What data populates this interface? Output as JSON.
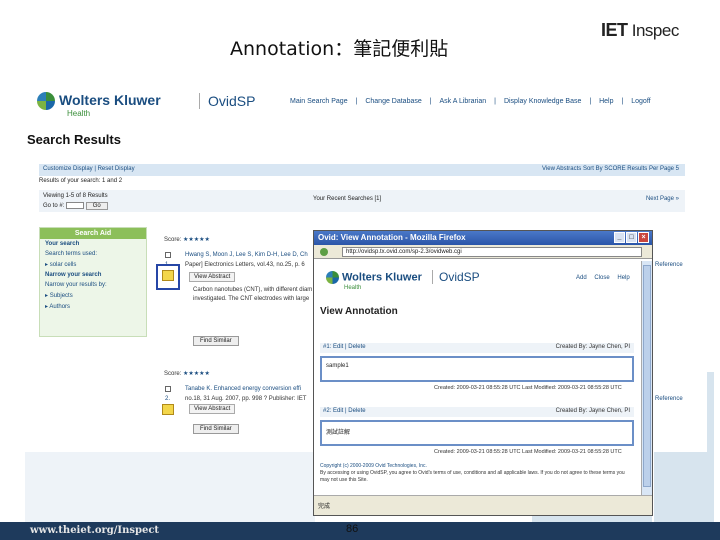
{
  "slide": {
    "title": "Annotation：筆記便利貼",
    "logo_iet": "IET",
    "logo_inspec": "Inspec",
    "footer_url": "www.theiet.org/Inspect",
    "page_number": "86"
  },
  "ovid": {
    "brand": "Wolters Kluwer",
    "brand_sub": "Health",
    "product": "OvidSP",
    "nav": [
      "Main Search Page",
      "|",
      "Change Database",
      "|",
      "Ask A Librarian",
      "|",
      "Display Knowledge Base",
      "|",
      "Help",
      "|",
      "Logoff"
    ],
    "page_title": "Search Results",
    "customize_display": "Customize Display",
    "reset_display": "Reset Display",
    "sort_right": "View Abstracts   Sort By  SCORE   Results Per Page  5",
    "results_header": "Results of your search: 1 and 2",
    "viewing": "Viewing 1-5 of 8 Results",
    "goto": "Go to #:",
    "goto_btn": "Go",
    "recent_searches": "Your Recent Searches [1]",
    "next_page": "Next Page",
    "search_aid": {
      "header": "Search Aid",
      "your_search": "Your search",
      "terms_used": "Search terms used:",
      "term": "solar cells",
      "narrow": "Narrow your search",
      "narrow_by": "Narrow your results by:",
      "subjects": "Subjects",
      "authors": "Authors"
    },
    "records": [
      {
        "score_label": "Score:",
        "stars": "★★★★★",
        "number": "1.",
        "authors": "Hwang S, Moon J, Lee S, Kim D-H, Lee D, Ch",
        "source": "Paper] Electronics Letters, vol.43, no.25, p. 6",
        "view_abstract": "View Abstract",
        "abstract": "Carbon nanotubes (CNT), with different diam",
        "abstract2": "investigated. The CNT electrodes with large",
        "find_similar": "Find Similar",
        "reference": "Reference"
      },
      {
        "score_label": "Score:",
        "stars": "★★★★★",
        "number": "2.",
        "authors": "Tanabe K. Enhanced energy conversion effi",
        "source": "no.18, 31 Aug. 2007, pp. 998 ? Publisher: IET",
        "view_abstract": "View Abstract",
        "find_similar": "Find Similar",
        "reference": "Reference"
      }
    ]
  },
  "popup": {
    "window_title": "Ovid: View Annotation - Mozilla Firefox",
    "url": "http://ovidsp.tx.ovid.com/sp-2.3/ovidweb.cgi",
    "brand": "Wolters Kluwer",
    "brand_sub": "Health",
    "product": "OvidSP",
    "nav": [
      "Add",
      "Close",
      "Help"
    ],
    "heading": "View Annotation",
    "annotations": [
      {
        "tag": "#1: Edit  |  Delete",
        "created_by": "Created By: Jayne Chen, PI",
        "text": "sample1",
        "meta": "Created: 2009-03-21 08:55:28 UTC     Last Modified: 2009-03-21 08:55:28 UTC"
      },
      {
        "tag": "#2: Edit  |  Delete",
        "created_by": "Created By: Jayne Chen, PI",
        "text": "測試註解",
        "meta": "Created: 2009-03-21 08:55:28 UTC     Last Modified: 2009-03-21 08:55:28 UTC"
      }
    ],
    "copyright": "Copyright (c) 2000-2009 Ovid Technologies, Inc.",
    "terms": "By accessing or using OvidSP, you agree to Ovid's terms of use, conditions and all applicable laws. If you do not agree to these terms you may not use this Site.",
    "status": "完成"
  }
}
